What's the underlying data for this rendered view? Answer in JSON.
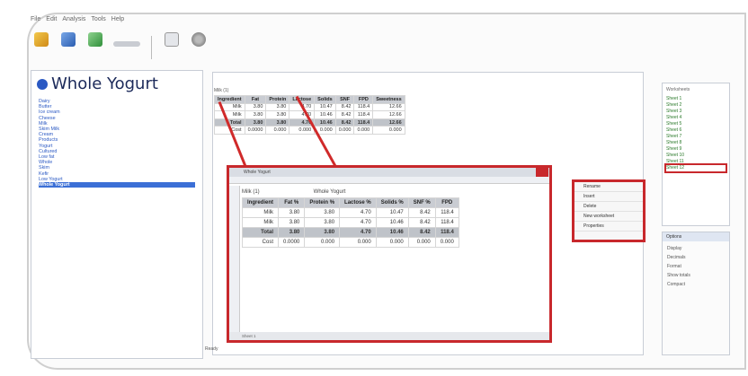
{
  "app": {
    "menu": [
      "File",
      "Edit",
      "Analysis",
      "Tools",
      "Help"
    ]
  },
  "toolbar": {
    "buttons": [
      {
        "label": "",
        "icon": "edit-icon"
      },
      {
        "label": "",
        "icon": "document-icon"
      },
      {
        "label": "",
        "icon": "search-icon"
      },
      {
        "label": "",
        "icon": "slider-icon"
      },
      {
        "label": "",
        "icon": "page-icon"
      },
      {
        "label": "",
        "icon": "settings-icon"
      }
    ]
  },
  "left_panel": {
    "title": "Whole Yogurt",
    "tree": [
      "Dairy",
      "Butter",
      "Ice cream",
      "Cheese",
      "Milk",
      "Skim Milk",
      "Cream",
      "Products",
      "Yogurt",
      "Cultured",
      "Low fat",
      "Whole",
      "Skim",
      "Kefir",
      "Low Yogurt",
      "Whole Yogurt"
    ],
    "selected": "Whole Yogurt"
  },
  "top_grid": {
    "cell_label": "Milk (1)",
    "headers": [
      "Ingredient",
      "Fat",
      "Protein",
      "Lactose",
      "Solids",
      "SNF",
      "FPD",
      "Sweetness"
    ],
    "rows": [
      [
        "Milk",
        "3.80",
        "3.80",
        "4.70",
        "10.47",
        "8.42",
        "118.4",
        "12.66"
      ],
      [
        "Milk",
        "3.80",
        "3.80",
        "4.70",
        "10.46",
        "8.42",
        "118.4",
        "12.66"
      ],
      [
        "Total",
        "3.80",
        "3.80",
        "4.70",
        "10.46",
        "8.42",
        "118.4",
        "12.66"
      ],
      [
        "Cost",
        "0.0000",
        "0.000",
        "0.000",
        "0.000",
        "0.000",
        "0.000",
        "0.000"
      ]
    ]
  },
  "popup": {
    "title": "Whole Yogurt",
    "cell_label": "Milk (1)",
    "heading": "Whole Yogurt",
    "headers": [
      "Ingredient",
      "Fat %",
      "Protein %",
      "Lactose %",
      "Solids %",
      "SNF %",
      "FPD"
    ],
    "rows": [
      [
        "Milk",
        "3.80",
        "3.80",
        "4.70",
        "10.47",
        "8.42",
        "118.4"
      ],
      [
        "Milk",
        "3.80",
        "3.80",
        "4.70",
        "10.46",
        "8.42",
        "118.4"
      ],
      [
        "Total",
        "3.80",
        "3.80",
        "4.70",
        "10.46",
        "8.42",
        "118.4"
      ],
      [
        "Cost",
        "0.0000",
        "0.000",
        "0.000",
        "0.000",
        "0.000",
        "0.000"
      ]
    ],
    "status": "Sheet 1"
  },
  "context_menu": {
    "items": [
      "Rename",
      "Insert",
      "Delete",
      "New worksheet",
      "Properties"
    ]
  },
  "right_panel": {
    "title": "Worksheets",
    "items": [
      "Sheet 1",
      "Sheet 2",
      "Sheet 3",
      "Sheet 4",
      "Sheet 5",
      "Sheet 6",
      "Sheet 7",
      "Sheet 8",
      "Sheet 9",
      "Sheet 10",
      "Sheet 11",
      "Sheet 12"
    ],
    "selected_index": 11
  },
  "right_lower": {
    "title": "Options",
    "options": [
      "Display",
      "Decimals",
      "Format",
      "Show totals",
      "Compact"
    ]
  },
  "status": {
    "text": "Ready"
  },
  "colors": {
    "highlight_red": "#c8282c",
    "tree_blue": "#2b59c3",
    "tree_selected": "#3b6fd6",
    "header_gray": "#c9ccd2"
  }
}
